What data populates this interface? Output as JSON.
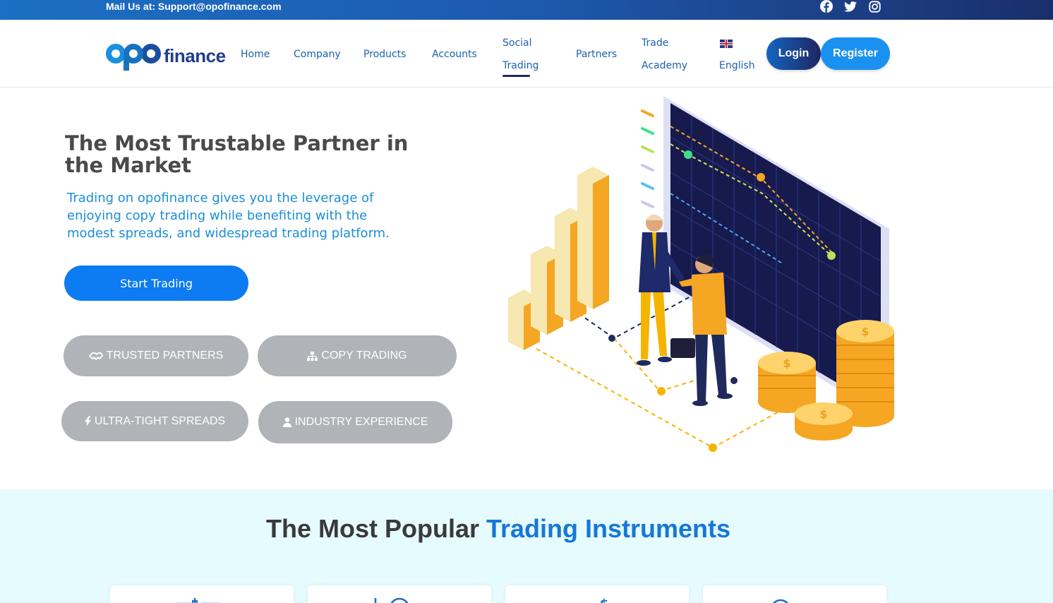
{
  "topbar": {
    "mail_text": "Mail Us at: Support@opofinance.com",
    "social_icons": [
      "facebook-icon",
      "twitter-icon",
      "instagram-icon"
    ]
  },
  "logo": {
    "text": "finance"
  },
  "nav": {
    "home": "Home",
    "company": "Company",
    "products": "Products",
    "accounts": "Accounts",
    "social_trading_line1": "Social",
    "social_trading_line2": "Trading",
    "partners": "Partners",
    "trade_academy_line1": "Trade",
    "trade_academy_line2": "Academy",
    "language": "English",
    "login": "Login",
    "register": "Register"
  },
  "hero": {
    "title": "The Most Trustable Partner in the Market",
    "subtitle": "Trading on opofinance gives you the leverage of enjoying copy trading while benefiting with the modest spreads, and widespread trading platform.",
    "cta": "Start Trading",
    "features": [
      {
        "label": "TRUSTED PARTNERS",
        "icon": "handshake-icon"
      },
      {
        "label": "COPY TRADING",
        "icon": "sitemap-icon"
      },
      {
        "label": "ULTRA-TIGHT SPREADS",
        "icon": "bolt-icon"
      },
      {
        "label": "INDUSTRY EXPERIENCE",
        "icon": "user-icon"
      }
    ]
  },
  "instruments": {
    "title_plain": "The Most Popular ",
    "title_highlight": "Trading Instruments"
  },
  "colors": {
    "primary_blue": "#0d7bf2",
    "register_blue": "#1a91f0",
    "nav_blue": "#1d5fb0",
    "pill_gray": "#b0b3b7",
    "section_bg": "#e6fbfd"
  }
}
